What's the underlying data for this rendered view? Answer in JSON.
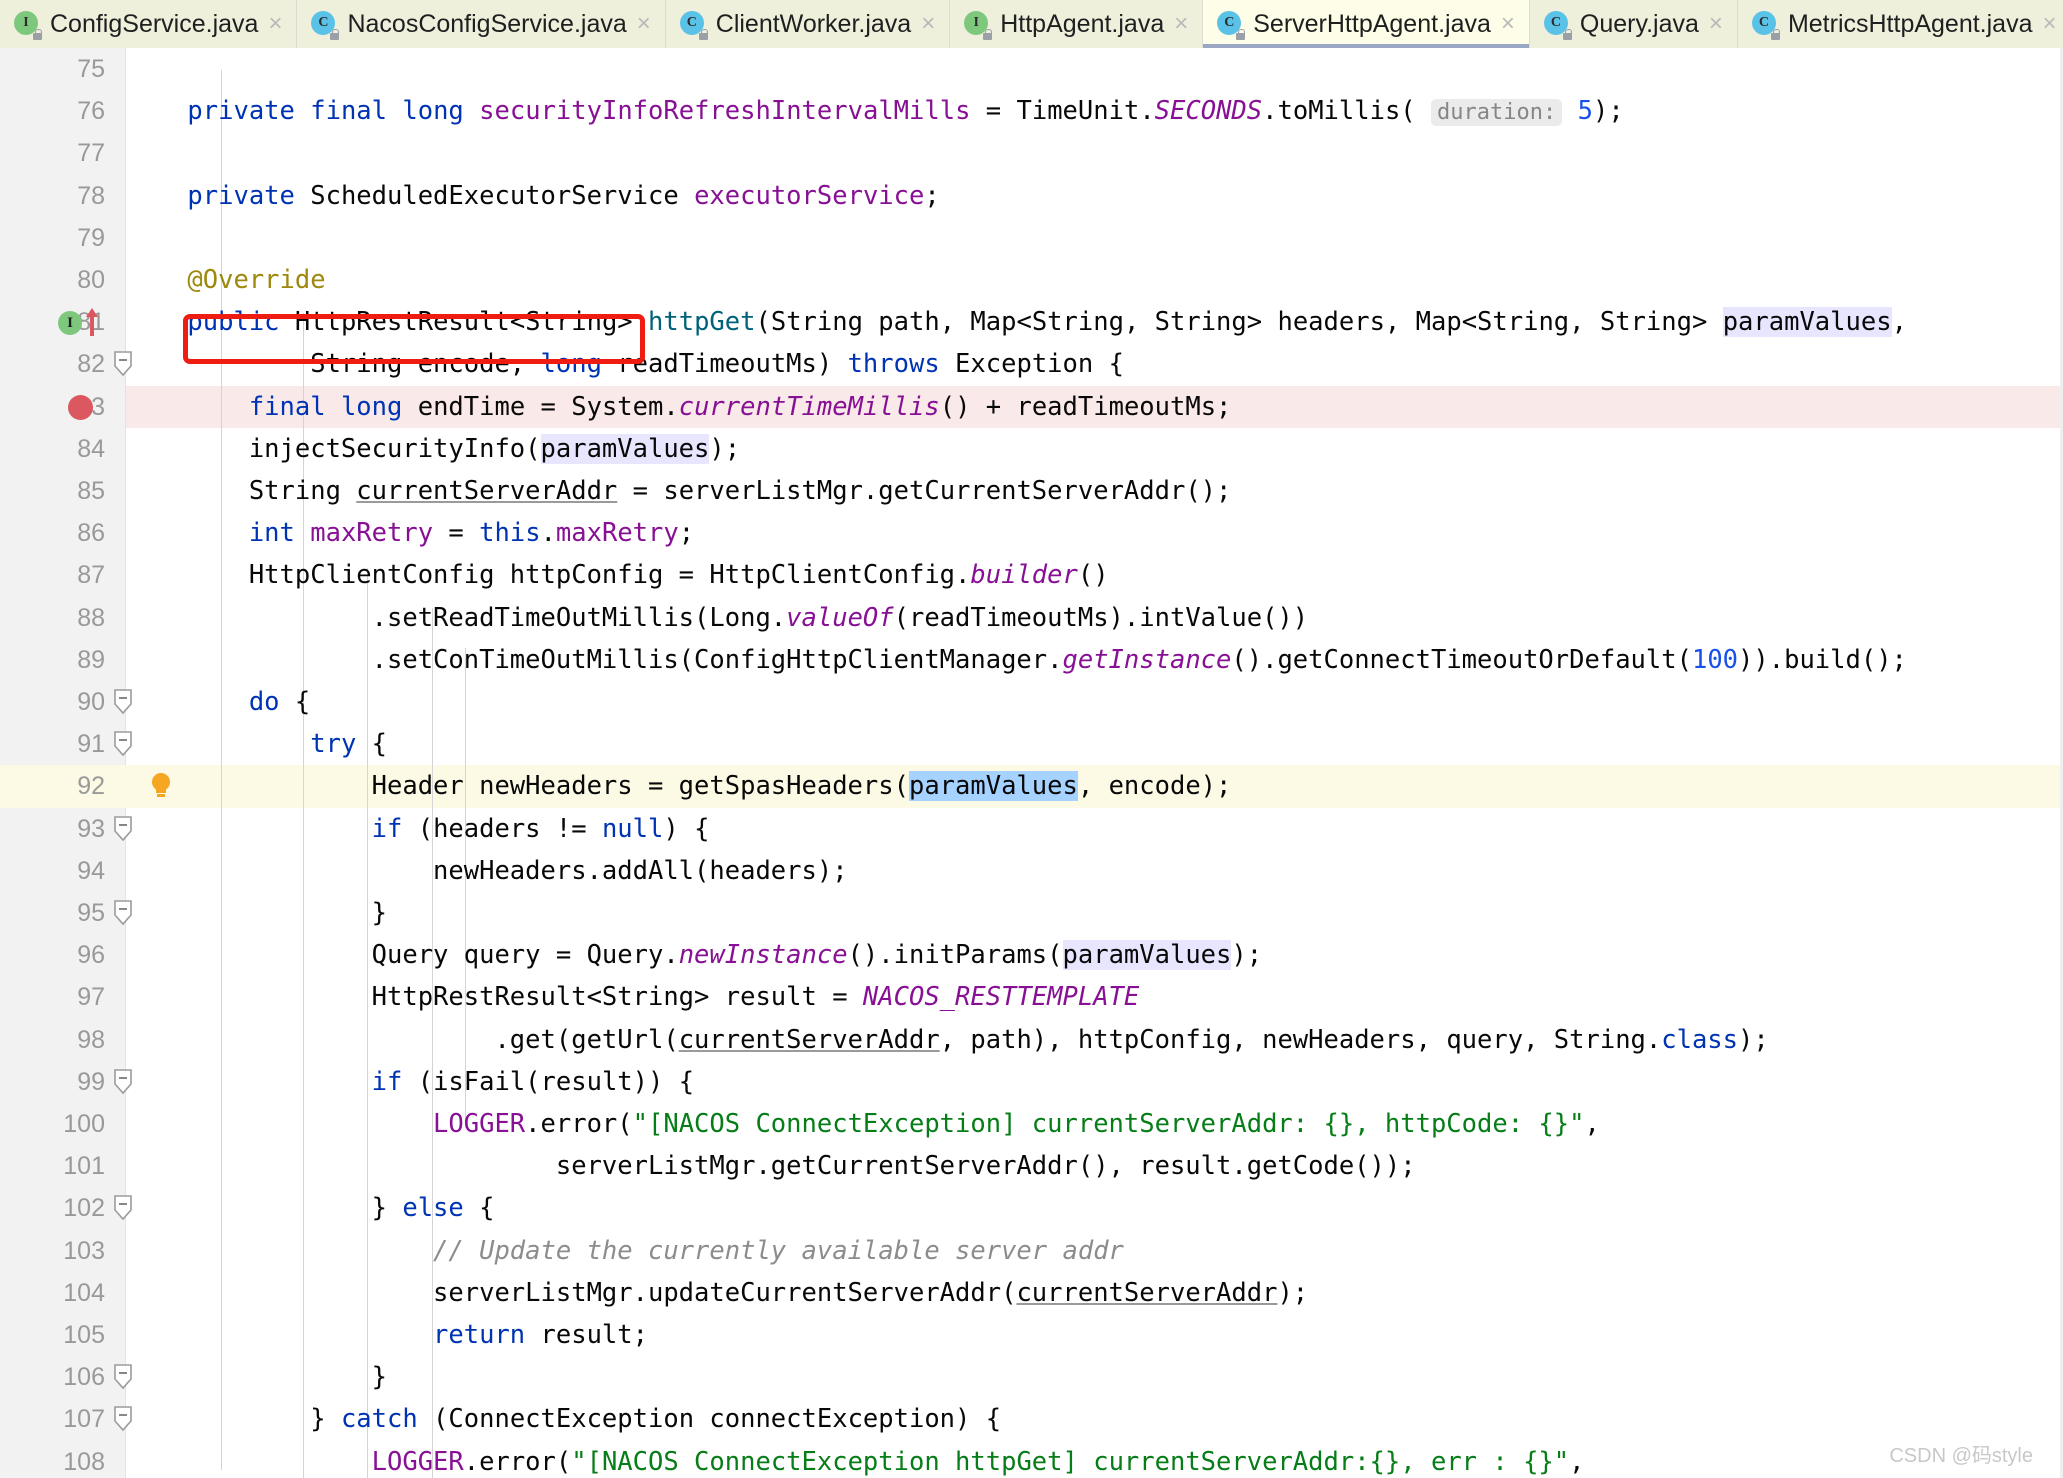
{
  "window": {
    "app": "IntelliJ IDEA",
    "watermark": "CSDN @码style"
  },
  "tabs": [
    {
      "label": "ConfigService.java",
      "icon": "interface-icon",
      "icon_letter": "I",
      "kind": "iface",
      "active": false,
      "close": "×"
    },
    {
      "label": "NacosConfigService.java",
      "icon": "class-icon",
      "icon_letter": "C",
      "kind": "cls",
      "active": false,
      "close": "×"
    },
    {
      "label": "ClientWorker.java",
      "icon": "class-icon",
      "icon_letter": "C",
      "kind": "cls",
      "active": false,
      "close": "×"
    },
    {
      "label": "HttpAgent.java",
      "icon": "interface-icon",
      "icon_letter": "I",
      "kind": "iface",
      "active": false,
      "close": "×"
    },
    {
      "label": "ServerHttpAgent.java",
      "icon": "class-icon",
      "icon_letter": "C",
      "kind": "cls",
      "active": true,
      "close": "×"
    },
    {
      "label": "Query.java",
      "icon": "class-icon",
      "icon_letter": "C",
      "kind": "cls",
      "active": false,
      "close": "×"
    },
    {
      "label": "MetricsHttpAgent.java",
      "icon": "class-icon",
      "icon_letter": "C",
      "kind": "cls",
      "active": false,
      "close": "×"
    }
  ],
  "editor": {
    "language": "java",
    "file": "ServerHttpAgent.java",
    "first_line": 75,
    "last_line": 108,
    "inlay_hints": [
      {
        "line": 76,
        "text": "duration:"
      }
    ],
    "gutter_markers": [
      {
        "line": 81,
        "type": "implementing-method-icon",
        "letter": "I"
      },
      {
        "line": 81,
        "type": "override-arrow-icon"
      },
      {
        "line": 82,
        "type": "fold-marker"
      },
      {
        "line": 83,
        "type": "breakpoint"
      },
      {
        "line": 90,
        "type": "fold-marker"
      },
      {
        "line": 91,
        "type": "fold-marker"
      },
      {
        "line": 92,
        "type": "intention-bulb-icon"
      },
      {
        "line": 93,
        "type": "fold-marker"
      },
      {
        "line": 95,
        "type": "fold-marker"
      },
      {
        "line": 99,
        "type": "fold-marker"
      },
      {
        "line": 102,
        "type": "fold-marker"
      },
      {
        "line": 106,
        "type": "fold-marker"
      },
      {
        "line": 107,
        "type": "fold-marker"
      }
    ],
    "annotation": {
      "type": "red-rectangle",
      "target_line": 84,
      "color": "#ef1c12"
    },
    "highlight": {
      "breakpoint_line": 83,
      "breakpoint_line_color": "#fae9e9",
      "caret_line": 92,
      "caret_line_color": "#fcfae5",
      "selection_token": "paramValues",
      "selection_color": "#a6d2ff"
    },
    "lines": [
      {
        "n": 75,
        "text": ""
      },
      {
        "n": 76,
        "text": "    private final long securityInfoRefreshIntervalMills = TimeUnit.SECONDS.toMillis( duration: 5);"
      },
      {
        "n": 77,
        "text": ""
      },
      {
        "n": 78,
        "text": "    private ScheduledExecutorService executorService;"
      },
      {
        "n": 79,
        "text": ""
      },
      {
        "n": 80,
        "text": "    @Override"
      },
      {
        "n": 81,
        "text": "    public HttpRestResult<String> httpGet(String path, Map<String, String> headers, Map<String, String> paramValues,"
      },
      {
        "n": 82,
        "text": "            String encode, long readTimeoutMs) throws Exception {"
      },
      {
        "n": 83,
        "text": "        final long endTime = System.currentTimeMillis() + readTimeoutMs;"
      },
      {
        "n": 84,
        "text": "        injectSecurityInfo(paramValues);"
      },
      {
        "n": 85,
        "text": "        String currentServerAddr = serverListMgr.getCurrentServerAddr();"
      },
      {
        "n": 86,
        "text": "        int maxRetry = this.maxRetry;"
      },
      {
        "n": 87,
        "text": "        HttpClientConfig httpConfig = HttpClientConfig.builder()"
      },
      {
        "n": 88,
        "text": "                .setReadTimeOutMillis(Long.valueOf(readTimeoutMs).intValue())"
      },
      {
        "n": 89,
        "text": "                .setConTimeOutMillis(ConfigHttpClientManager.getInstance().getConnectTimeoutOrDefault(100)).build();"
      },
      {
        "n": 90,
        "text": "        do {"
      },
      {
        "n": 91,
        "text": "            try {"
      },
      {
        "n": 92,
        "text": "                Header newHeaders = getSpasHeaders(paramValues, encode);"
      },
      {
        "n": 93,
        "text": "                if (headers != null) {"
      },
      {
        "n": 94,
        "text": "                    newHeaders.addAll(headers);"
      },
      {
        "n": 95,
        "text": "                }"
      },
      {
        "n": 96,
        "text": "                Query query = Query.newInstance().initParams(paramValues);"
      },
      {
        "n": 97,
        "text": "                HttpRestResult<String> result = NACOS_RESTTEMPLATE"
      },
      {
        "n": 98,
        "text": "                        .get(getUrl(currentServerAddr, path), httpConfig, newHeaders, query, String.class);"
      },
      {
        "n": 99,
        "text": "                if (isFail(result)) {"
      },
      {
        "n": 100,
        "text": "                    LOGGER.error(\"[NACOS ConnectException] currentServerAddr: {}, httpCode: {}\","
      },
      {
        "n": 101,
        "text": "                            serverListMgr.getCurrentServerAddr(), result.getCode());"
      },
      {
        "n": 102,
        "text": "                } else {"
      },
      {
        "n": 103,
        "text": "                    // Update the currently available server addr"
      },
      {
        "n": 104,
        "text": "                    serverListMgr.updateCurrentServerAddr(currentServerAddr);"
      },
      {
        "n": 105,
        "text": "                    return result;"
      },
      {
        "n": 106,
        "text": "                }"
      },
      {
        "n": 107,
        "text": "            } catch (ConnectException connectException) {"
      },
      {
        "n": 108,
        "text": "                LOGGER.error(\"[NACOS ConnectException httpGet] currentServerAddr:{}, err : {}\","
      }
    ]
  }
}
